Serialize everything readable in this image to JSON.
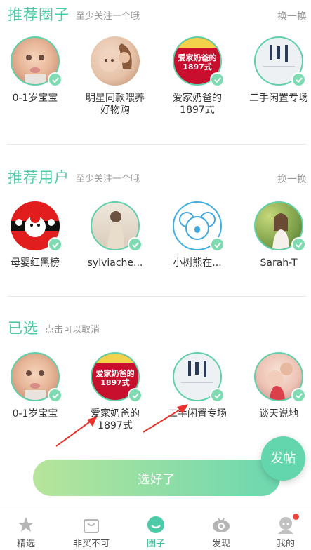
{
  "sections": {
    "circles": {
      "title": "推荐圈子",
      "hint": "至少关注一个哦",
      "refresh": "换一换",
      "items": [
        {
          "label": "0-1岁宝宝"
        },
        {
          "label": "明星同款喂养好物购"
        },
        {
          "label": "爱家奶爸的1897式",
          "badge": "爱家奶爸的 1897式"
        },
        {
          "label": "二手闲置专场"
        }
      ]
    },
    "users": {
      "title": "推荐用户",
      "hint": "至少关注一个哦",
      "refresh": "换一换",
      "items": [
        {
          "label": "母婴红黑榜"
        },
        {
          "label": "sylviache..."
        },
        {
          "label": "小树熊在..."
        },
        {
          "label": "Sarah-T"
        }
      ]
    },
    "selected": {
      "title": "已选",
      "hint": "点击可以取消",
      "items": [
        {
          "label": "0-1岁宝宝"
        },
        {
          "label": "爱家奶爸的1897式",
          "badge": "爱家奶爸的 1897式"
        },
        {
          "label": "二手闲置专场"
        },
        {
          "label": "谈天说地"
        }
      ]
    }
  },
  "submit_label": "选好了",
  "fab_label": "发帖",
  "tabs": [
    {
      "label": "精选",
      "icon": "star-icon"
    },
    {
      "label": "非买不可",
      "icon": "bag-icon"
    },
    {
      "label": "圈子",
      "icon": "smile-icon",
      "active": true
    },
    {
      "label": "发现",
      "icon": "eye-icon"
    },
    {
      "label": "我的",
      "icon": "profile-icon",
      "notification": true
    }
  ],
  "colors": {
    "accent": "#4cc9a6",
    "check": "#7fdcb2",
    "badge_red": "#c8102e",
    "notification": "#f0463c"
  }
}
